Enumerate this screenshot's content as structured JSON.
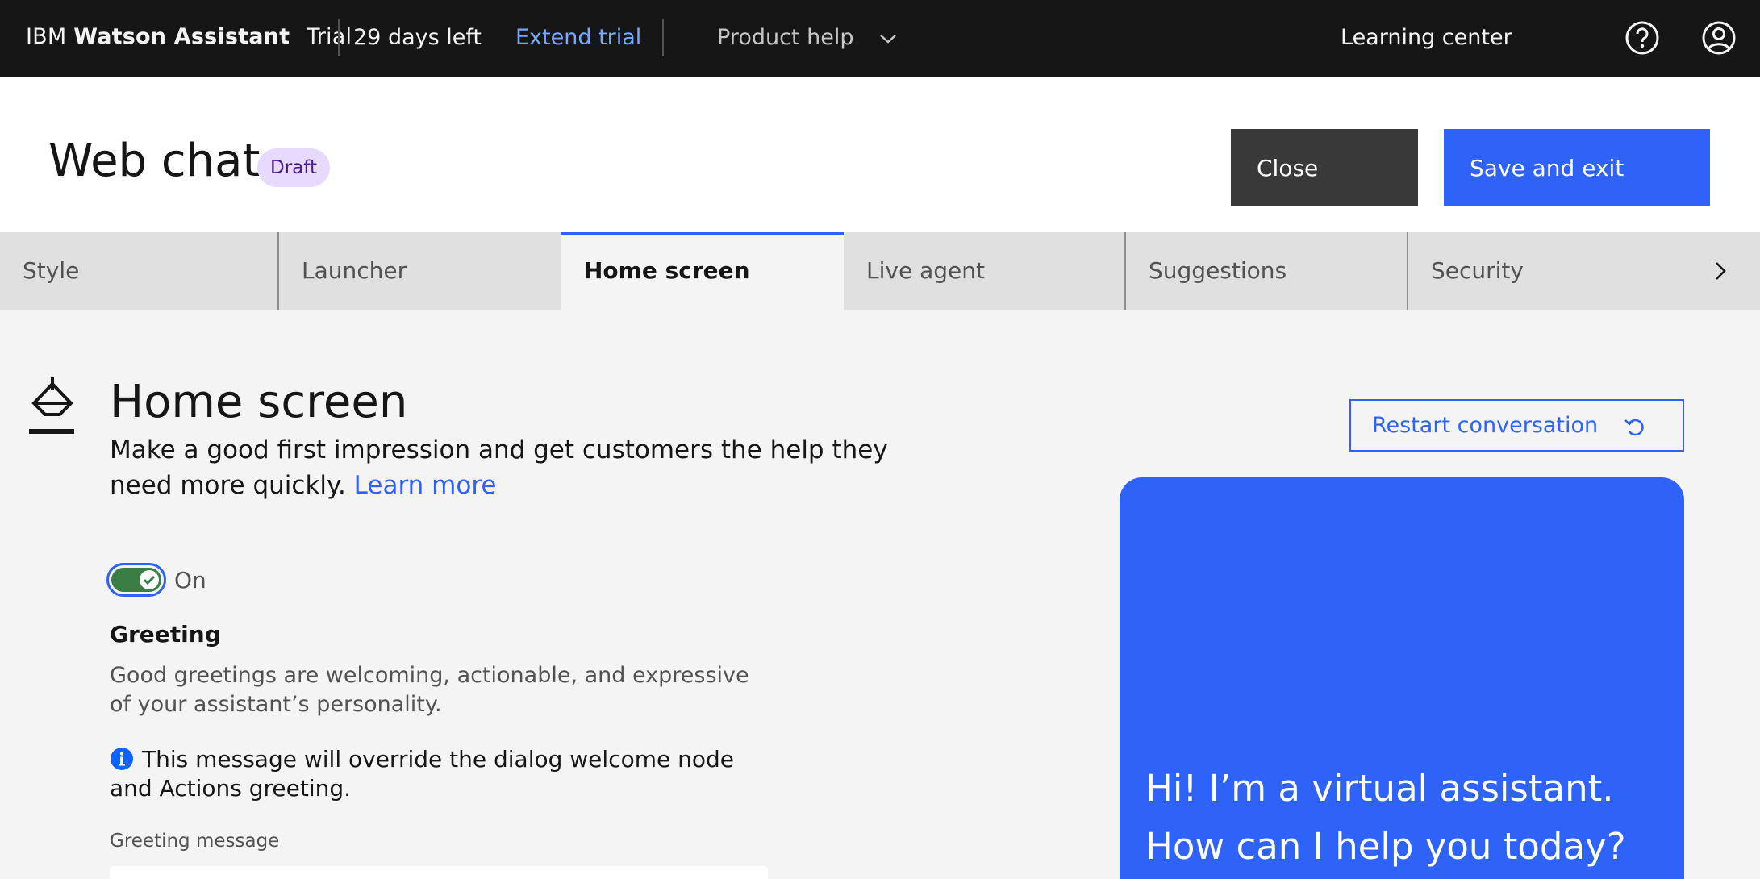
{
  "header": {
    "brand_ibm": "IBM",
    "brand_product": "Watson Assistant",
    "plan": "Trial",
    "days_left": "29 days left",
    "extend_trial": "Extend trial",
    "product_help": "Product help",
    "learning_center": "Learning center",
    "icons": [
      "help-icon",
      "user-avatar-icon"
    ]
  },
  "page": {
    "title": "Web chat",
    "status_tag": "Draft",
    "close_label": "Close",
    "save_label": "Save and exit"
  },
  "tabs": [
    {
      "label": "Style",
      "active": false
    },
    {
      "label": "Launcher",
      "active": false
    },
    {
      "label": "Home screen",
      "active": true
    },
    {
      "label": "Live agent",
      "active": false
    },
    {
      "label": "Suggestions",
      "active": false
    },
    {
      "label": "Security",
      "active": false
    }
  ],
  "section": {
    "title": "Home screen",
    "description": "Make a good first impression and get customers the help they need more quickly.",
    "learn_more": "Learn more",
    "toggle_label": "On",
    "toggle_on": true,
    "greeting_heading": "Greeting",
    "greeting_description": "Good greetings are welcoming, actionable, and expressive of your assistant’s personality.",
    "override_notice": "This message will override the dialog welcome node and Actions greeting.",
    "greeting_message_label": "Greeting message"
  },
  "preview": {
    "restart_label": "Restart conversation",
    "greeting_text": "Hi! I’m a virtual assistant. How can I help you today?"
  },
  "colors": {
    "accent": "#2f62f6",
    "header_bg": "#161616",
    "toggle_on": "#3a7d45",
    "draft_tag_bg": "#e8daff",
    "link_light": "#78a9ff"
  }
}
